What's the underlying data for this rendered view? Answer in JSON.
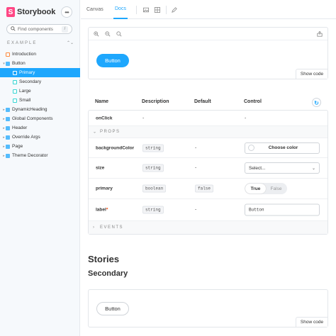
{
  "brand": {
    "name": "Storybook",
    "logo_letter": "S"
  },
  "sidebar": {
    "search_placeholder": "Find components",
    "search_shortcut": "/",
    "section_label": "EXAMPLE",
    "items": [
      {
        "label": "Introduction",
        "kind": "doc",
        "depth": 0,
        "arrow": ""
      },
      {
        "label": "Button",
        "kind": "comp",
        "depth": 0,
        "arrow": "▾"
      },
      {
        "label": "Primary",
        "kind": "story",
        "depth": 1,
        "arrow": "",
        "selected": true
      },
      {
        "label": "Secondary",
        "kind": "story",
        "depth": 1,
        "arrow": ""
      },
      {
        "label": "Large",
        "kind": "story",
        "depth": 1,
        "arrow": ""
      },
      {
        "label": "Small",
        "kind": "story",
        "depth": 1,
        "arrow": ""
      },
      {
        "label": "DynamicHeading",
        "kind": "comp",
        "depth": 0,
        "arrow": "▸"
      },
      {
        "label": "Global Components",
        "kind": "comp",
        "depth": 0,
        "arrow": "▸"
      },
      {
        "label": "Header",
        "kind": "comp",
        "depth": 0,
        "arrow": "▸"
      },
      {
        "label": "Override Args",
        "kind": "comp",
        "depth": 0,
        "arrow": "▸"
      },
      {
        "label": "Page",
        "kind": "comp",
        "depth": 0,
        "arrow": "▸"
      },
      {
        "label": "Theme Decorator",
        "kind": "comp",
        "depth": 0,
        "arrow": "▸"
      }
    ]
  },
  "toolbar": {
    "tab_canvas": "Canvas",
    "tab_docs": "Docs",
    "active_tab": "Docs"
  },
  "preview1": {
    "button_label": "Button",
    "show_code": "Show code"
  },
  "args": {
    "headers": {
      "name": "Name",
      "description": "Description",
      "default": "Default",
      "control": "Control"
    },
    "onclick": {
      "name": "onClick",
      "description": "-",
      "control": "-"
    },
    "props_group": "PROPS",
    "events_group": "EVENTS",
    "rows": {
      "backgroundColor": {
        "name": "backgroundColor",
        "type": "string",
        "default": "-",
        "control_label": "Choose color"
      },
      "size": {
        "name": "size",
        "type": "string",
        "default": "-",
        "select_value": "Select..."
      },
      "primary": {
        "name": "primary",
        "type": "boolean",
        "default": "false",
        "toggle_true": "True",
        "toggle_false": "False"
      },
      "label": {
        "name": "label",
        "required": "*",
        "type": "string",
        "default": "-",
        "input_value": "Button"
      }
    }
  },
  "stories_heading": "Stories",
  "secondary_heading": "Secondary",
  "preview2": {
    "button_label": "Button",
    "show_code": "Show code"
  },
  "colors": {
    "accent": "#1ea7fd",
    "brand": "#ff4785"
  }
}
